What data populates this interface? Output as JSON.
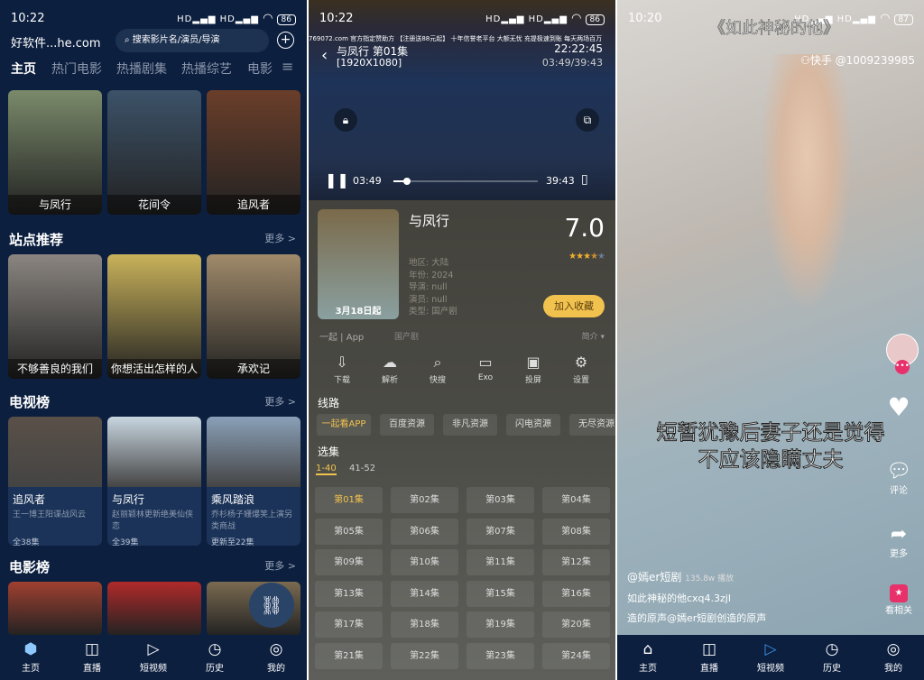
{
  "home": {
    "status": {
      "time": "10:22",
      "signal": "HD▂▄▆ HD▂▄▆",
      "battery": "86"
    },
    "app_title": "好软件...he.com",
    "search_placeholder": "搜索影片名/演员/导演",
    "tabs": [
      "主页",
      "热门电影",
      "热播剧集",
      "热播综艺",
      "电影"
    ],
    "top_posters": [
      {
        "label": "与凤行",
        "color": "#7a8a6a"
      },
      {
        "label": "花间令",
        "color": "#3c5268"
      },
      {
        "label": "追风者",
        "color": "#6a3e2a"
      }
    ],
    "site_section": {
      "title": "站点推荐",
      "more": "更多 >",
      "items": [
        {
          "label": "不够善良的我们",
          "color": "#8a8580"
        },
        {
          "label": "你想活出怎样的人生",
          "color": "#c9b25a"
        },
        {
          "label": "承欢记",
          "color": "#a08a6a"
        }
      ]
    },
    "tv_section": {
      "title": "电视榜",
      "more": "更多 >",
      "items": [
        {
          "title": "追风者",
          "desc": "王一博王阳谍战风云",
          "count": "全38集",
          "color": "#5a5048"
        },
        {
          "title": "与凤行",
          "desc": "赵丽颖林更新绝美仙侠恋",
          "count": "全39集",
          "color": "#c8d6e0"
        },
        {
          "title": "乘风踏浪",
          "desc": "乔杉杨子姗爆笑上演另类商战",
          "count": "更新至22集",
          "color": "#8aa0b8"
        }
      ]
    },
    "movie_section": {
      "title": "电影榜",
      "more": "更多 >",
      "colors": [
        "#a04030",
        "#b02a2a",
        "#7a6a50"
      ]
    },
    "nav": [
      {
        "label": "主页",
        "icon": "home-icon",
        "glyph": "⬢"
      },
      {
        "label": "直播",
        "icon": "live-camera-icon",
        "glyph": "◫"
      },
      {
        "label": "短视频",
        "icon": "play-circle-icon",
        "glyph": "▷"
      },
      {
        "label": "历史",
        "icon": "clock-icon",
        "glyph": "◷"
      },
      {
        "label": "我的",
        "icon": "profile-icon",
        "glyph": "◎"
      }
    ],
    "accent": "#3a8ee6"
  },
  "player": {
    "status": {
      "time": "10:22",
      "signal": "HD▂▄▆ HD▂▄▆",
      "battery": "86"
    },
    "marquee": "769072.com 官方指定赞助方 【注册送88元起】 十年信誉老平台 大额无忧 充提极速到账 每天两场百万",
    "title": "与凤行 第01集",
    "resolution": "[1920X1080]",
    "clock": "22:22:45",
    "progress_text": "03:49/39:43",
    "current": "03:49",
    "duration": "39:43",
    "progress": 0.096,
    "show": {
      "name": "与凤行",
      "poster_tag": "3月18日起",
      "rating": "7.0",
      "stars": 3.5,
      "region": "地区: 大陆",
      "year": "年份: 2024",
      "director": "导演: null",
      "actors": "演员: null",
      "genre": "类型: 国产剧",
      "fav": "加入收藏",
      "source_app": "一起 | App",
      "tag": "国产剧",
      "intro": "简介"
    },
    "actions": [
      {
        "label": "下载",
        "icon": "download-icon",
        "glyph": "⇩"
      },
      {
        "label": "解析",
        "icon": "cloud-icon",
        "glyph": "☁"
      },
      {
        "label": "快搜",
        "icon": "search-icon",
        "glyph": "⌕"
      },
      {
        "label": "Exo",
        "icon": "video-camera-icon",
        "glyph": "▭"
      },
      {
        "label": "投屏",
        "icon": "tv-cast-icon",
        "glyph": "▣"
      },
      {
        "label": "设置",
        "icon": "gear-icon",
        "glyph": "⚙"
      }
    ],
    "routes_title": "线路",
    "routes": [
      "一起看APP",
      "百度资源",
      "非凡资源",
      "闪电资源",
      "无尽资源"
    ],
    "episodes_title": "选集",
    "ranges": [
      "1-40",
      "41-52"
    ],
    "episodes": [
      "第01集",
      "第02集",
      "第03集",
      "第04集",
      "第05集",
      "第06集",
      "第07集",
      "第08集",
      "第09集",
      "第10集",
      "第11集",
      "第12集",
      "第13集",
      "第14集",
      "第15集",
      "第16集",
      "第17集",
      "第18集",
      "第19集",
      "第20集",
      "第21集",
      "第22集",
      "第23集",
      "第24集"
    ],
    "accent": "#f2c24e"
  },
  "short": {
    "status": {
      "time": "10:20",
      "signal": "HD▂▄▆ HD▂▄▆",
      "battery": "87"
    },
    "overlay_title": "《如此神秘的他》",
    "watermark": "快手 @1009239985",
    "subtitle1": "短暂犹豫后妻子还是觉得",
    "subtitle2": "不应该隐瞒丈夫",
    "author": "@嫣er短剧",
    "plays": "135.8w 播放",
    "desc": "如此神秘的他cxq4.3zjl",
    "music": "造的原声@嫣er短剧创造的原声",
    "side": {
      "comment": "评论",
      "more": "更多",
      "related": "看相关"
    },
    "nav": [
      {
        "label": "主页",
        "icon": "home-icon",
        "glyph": "⌂"
      },
      {
        "label": "直播",
        "icon": "live-camera-icon",
        "glyph": "◫"
      },
      {
        "label": "短视频",
        "icon": "play-circle-icon",
        "glyph": "▷"
      },
      {
        "label": "历史",
        "icon": "clock-icon",
        "glyph": "◷"
      },
      {
        "label": "我的",
        "icon": "profile-icon",
        "glyph": "◎"
      }
    ]
  }
}
